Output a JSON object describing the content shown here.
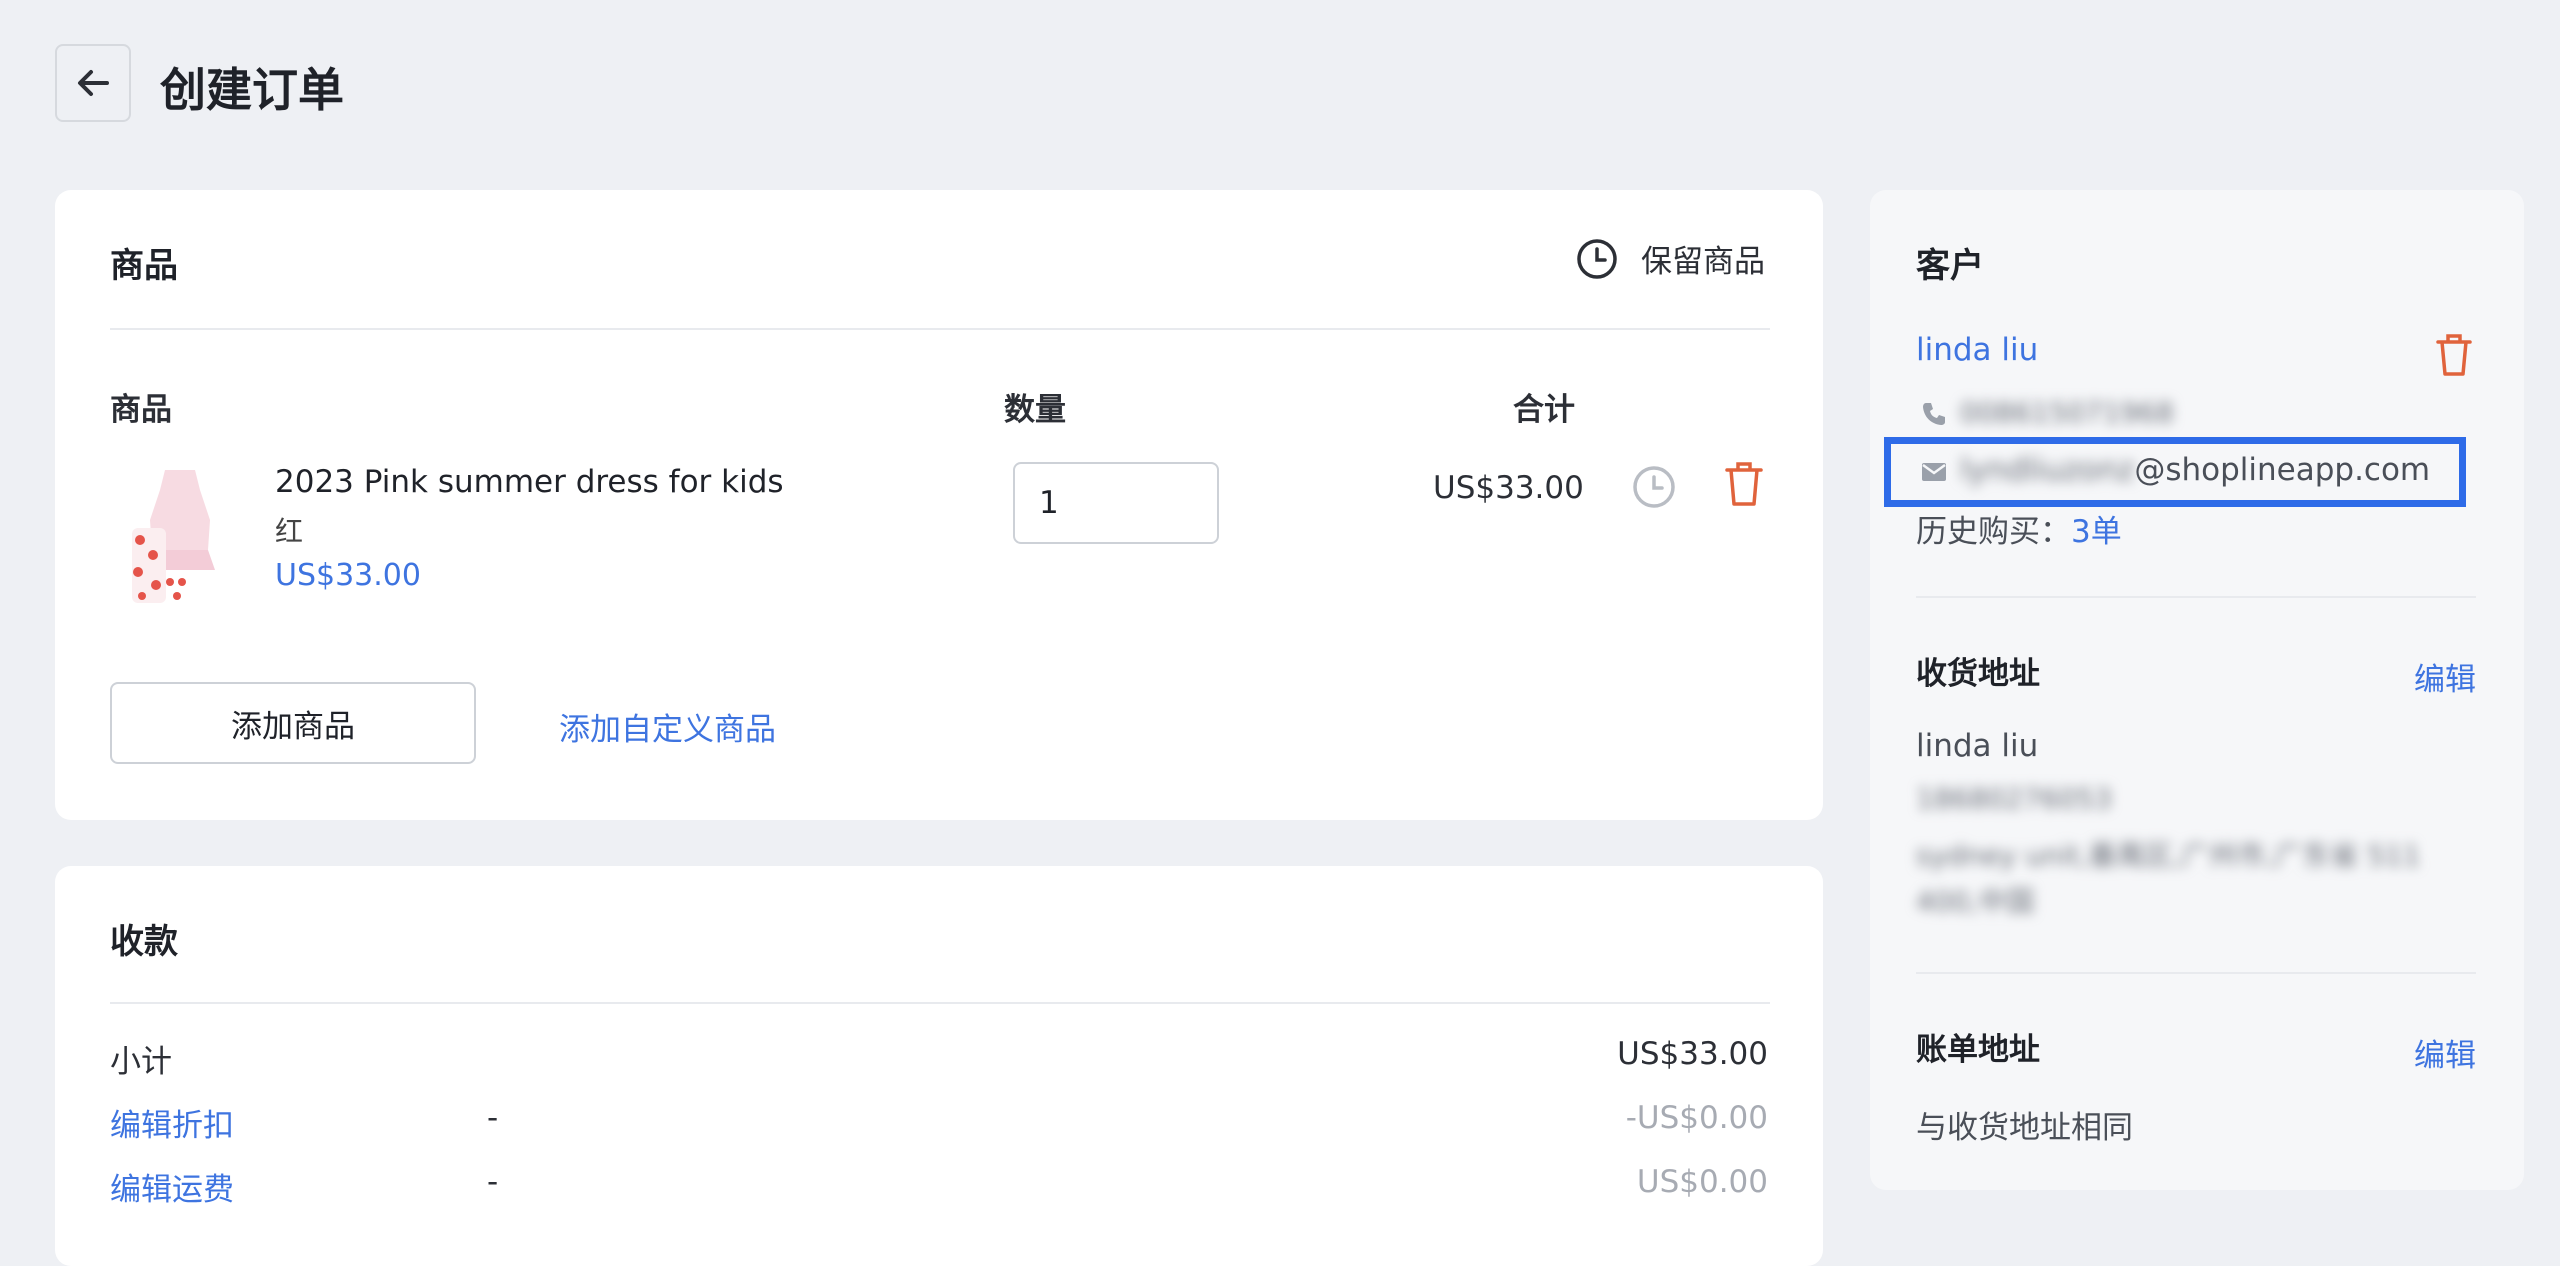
{
  "header": {
    "title": "创建订单"
  },
  "products": {
    "section_title": "商品",
    "hold_label": "保留商品",
    "columns": {
      "product": "商品",
      "quantity": "数量",
      "total": "合计"
    },
    "items": [
      {
        "name": "2023 Pink summer dress for kids",
        "variant": "红",
        "price": "US$33.00",
        "quantity": "1",
        "total": "US$33.00"
      }
    ],
    "add_product_label": "添加商品",
    "add_custom_product_label": "添加自定义商品"
  },
  "payment": {
    "section_title": "收款",
    "subtotal_label": "小计",
    "subtotal_value": "US$33.00",
    "discount_label": "编辑折扣",
    "discount_dash": "-",
    "discount_value": "-US$0.00",
    "shipping_label": "编辑运费",
    "shipping_dash": "-",
    "shipping_value": "US$0.00"
  },
  "customer": {
    "section_title": "客户",
    "name": "linda liu",
    "phone_blurred": "008615071968",
    "email_prefix_blurred": "lyndliuzonz",
    "email_domain": "@shoplineapp.com",
    "history_label": "历史购买：",
    "history_value": "3单",
    "shipping_title": "收货地址",
    "shipping_edit": "编辑",
    "shipping_name": "linda liu",
    "shipping_phone_blurred": "18680276053",
    "shipping_address_blurred_1": "sydney unit,番禺区,广州市,广东省 511",
    "shipping_address_blurred_2": "400,中国",
    "billing_title": "账单地址",
    "billing_edit": "编辑",
    "billing_same": "与收货地址相同"
  },
  "colors": {
    "accent": "#3e74e0",
    "danger": "#e0633c",
    "highlight": "#2e6be8"
  }
}
